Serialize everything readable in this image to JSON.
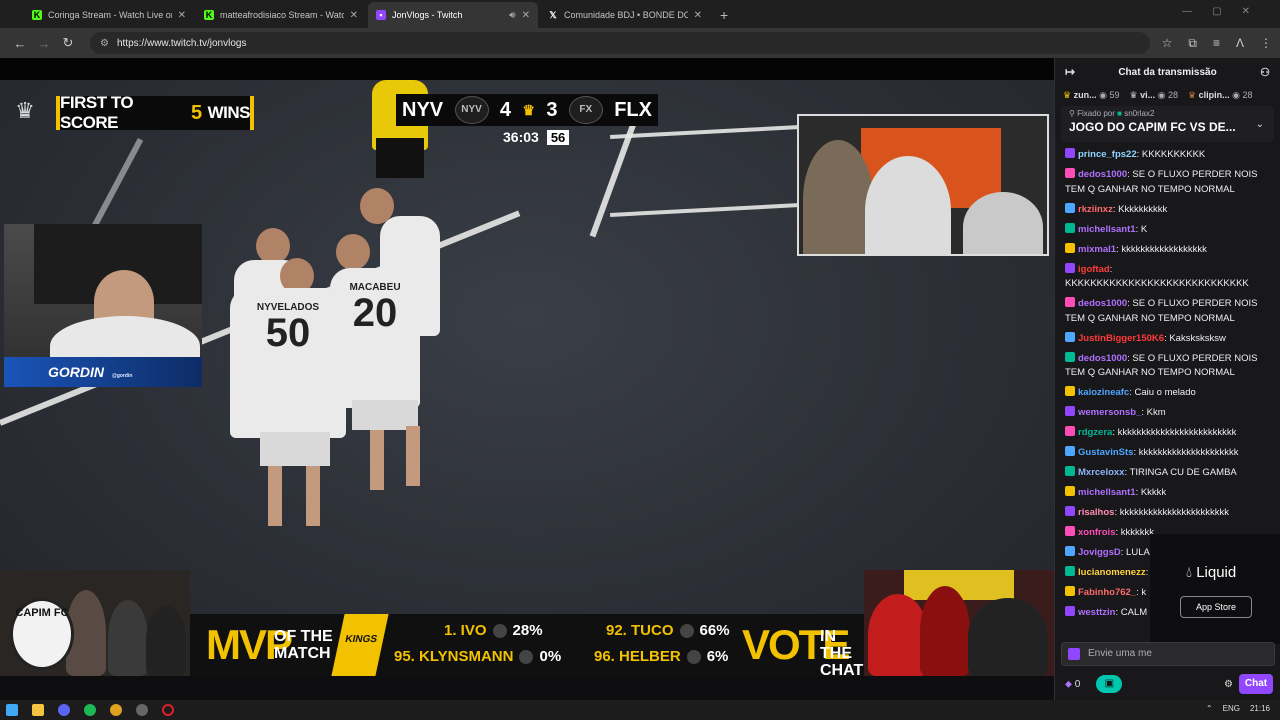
{
  "browser": {
    "tabs": [
      {
        "title": "Coringa Stream - Watch Live on",
        "icon": "kick-icon",
        "color": "#53fc18"
      },
      {
        "title": "matteafrodisiaco Stream - Watc",
        "icon": "kick-icon",
        "color": "#53fc18"
      },
      {
        "title": "JonVlogs - Twitch",
        "icon": "twitch-icon",
        "color": "#9147ff",
        "active": true
      },
      {
        "title": "Comunidade BDJ • BONDE DO",
        "icon": "x-icon",
        "color": "#ffffff"
      }
    ],
    "url": "https://www.twitch.tv/jonvlogs"
  },
  "stream": {
    "banner_prefix": "FIRST TO SCORE",
    "banner_num": "5",
    "banner_suffix": "WINS",
    "team_home": "NYV",
    "score_home": "4",
    "score_away": "3",
    "team_away": "FLX",
    "crest_home": "NYV",
    "crest_away": "FX",
    "clock": "36:03",
    "shot_clock": "56",
    "player1_name": "NYVELADOS",
    "player1_num": "50",
    "player2_name": "MACABEU",
    "player2_num": "20",
    "cam_label": "GORDIN",
    "cam_label_small": "@gordin",
    "capim_logo": "CAPIM FC",
    "mvp_word": "MVP",
    "mvp_sub1": "OF THE",
    "mvp_sub2": "MATCH",
    "kings": "KINGS",
    "candidates": [
      {
        "name": "1. IVO",
        "pct": "28%"
      },
      {
        "name": "95. KLYNSMANN",
        "pct": "0%"
      },
      {
        "name": "92. TUCO",
        "pct": "66%"
      },
      {
        "name": "96. HELBER",
        "pct": "6%"
      }
    ],
    "vote_word": "VOTE",
    "vote_sub1": "IN THE",
    "vote_sub2": "CHAT"
  },
  "chat": {
    "title": "Chat da transmissão",
    "leaders": [
      {
        "name": "zun...",
        "count": "59"
      },
      {
        "name": "vi...",
        "count": "28"
      },
      {
        "name": "clipin...",
        "count": "28"
      }
    ],
    "pinned_by": "Fixado por",
    "pinned_user": "sn0rlax2",
    "pinned_msg": "JOGO DO CAPIM FC VS DE...",
    "messages": [
      {
        "user": "prince_fps22",
        "color": "#8fd3ff",
        "text": "KKKKKKKKKK"
      },
      {
        "user": "dedos1000",
        "color": "#b070ff",
        "text": "SE O FLUXO PERDER NOIS TEM Q GANHAR NO TEMPO NORMAL"
      },
      {
        "user": "rkziinxz",
        "color": "#ff6b6b",
        "text": "Kkkkkkkkkk"
      },
      {
        "user": "michellsant1",
        "color": "#b070ff",
        "text": "K"
      },
      {
        "user": "mixmal1",
        "color": "#b070ff",
        "text": "kkkkkkkkkkkkkkkkkk"
      },
      {
        "user": "igoftad",
        "color": "#ff3a3a",
        "text": "KKKKKKKKKKKKKKKKKKKKKKKKKKKKK"
      },
      {
        "user": "dedos1000",
        "color": "#b070ff",
        "text": "SE O FLUXO PERDER NOIS TEM Q GANHAR NO TEMPO NORMAL"
      },
      {
        "user": "JustinBigger150K6",
        "color": "#ff3a3a",
        "text": "Kaksksksksw"
      },
      {
        "user": "dedos1000",
        "color": "#b070ff",
        "text": "SE O FLUXO PERDER NOIS TEM Q GANHAR NO TEMPO NORMAL"
      },
      {
        "user": "kaiozineafc",
        "color": "#4da6ff",
        "text": "Caiu o melado"
      },
      {
        "user": "wemersonsb_",
        "color": "#b070ff",
        "text": "Kkm"
      },
      {
        "user": "rdgzera",
        "color": "#00b894",
        "text": "kkkkkkkkkkkkkkkkkkkkkkkkk"
      },
      {
        "user": "GustavinSts",
        "color": "#4da6ff",
        "text": "kkkkkkkkkkkkkkkkkkkkk"
      },
      {
        "user": "Mxrceloxx",
        "color": "#8fb3ff",
        "text": "TIRINGA CU DE GAMBA"
      },
      {
        "user": "michellsant1",
        "color": "#b070ff",
        "text": "Kkkkk"
      },
      {
        "user": "risalhos",
        "color": "#ff8fb3",
        "text": "kkkkkkkkkkkkkkkkkkkkkkk"
      },
      {
        "user": "xonfrois",
        "color": "#ff4db8",
        "text": "kkkkkkk"
      },
      {
        "user": "JoviggsD",
        "color": "#b070ff",
        "text": "LULA"
      },
      {
        "user": "lucianomenezz",
        "color": "#ffd23f",
        "text": ""
      },
      {
        "user": "Fabinho762_",
        "color": "#ff6b6b",
        "text": "k"
      },
      {
        "user": "westtzin",
        "color": "#b070ff",
        "text": "CALM"
      }
    ],
    "ad_brand": "Liquid",
    "ad_store": "App Store",
    "input_placeholder": "Envie uma me",
    "points": "0",
    "chat_button": "Chat"
  },
  "taskbar": {
    "lang": "ENG",
    "time": "21:16"
  }
}
